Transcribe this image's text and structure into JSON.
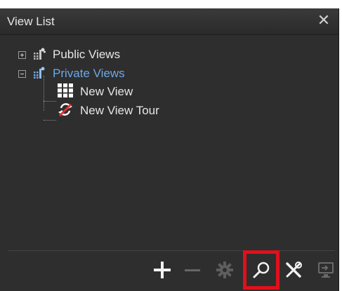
{
  "panel": {
    "title": "View List",
    "close_glyph": "✕"
  },
  "tree": {
    "items": [
      {
        "label": "Public Views",
        "icon": "public-views-icon",
        "expanded": false,
        "selected": false
      },
      {
        "label": "Private Views",
        "icon": "private-views-icon",
        "expanded": true,
        "selected": true,
        "children": [
          {
            "label": "New View",
            "icon": "grid-view-icon"
          },
          {
            "label": "New View Tour",
            "icon": "view-tour-icon"
          }
        ]
      }
    ]
  },
  "toolbar": {
    "buttons": [
      {
        "name": "add",
        "icon": "plus-icon",
        "enabled": true
      },
      {
        "name": "remove",
        "icon": "minus-icon",
        "enabled": false
      },
      {
        "name": "settings",
        "icon": "gear-icon",
        "enabled": false
      },
      {
        "name": "search",
        "icon": "search-icon",
        "enabled": true,
        "highlighted": true
      },
      {
        "name": "tools",
        "icon": "tools-icon",
        "enabled": true
      },
      {
        "name": "send-to-monitor",
        "icon": "monitor-icon",
        "enabled": false
      }
    ]
  },
  "colors": {
    "panel_bg": "#2e2e2e",
    "selected_text": "#6ea8e8",
    "highlight": "#e0101a"
  }
}
